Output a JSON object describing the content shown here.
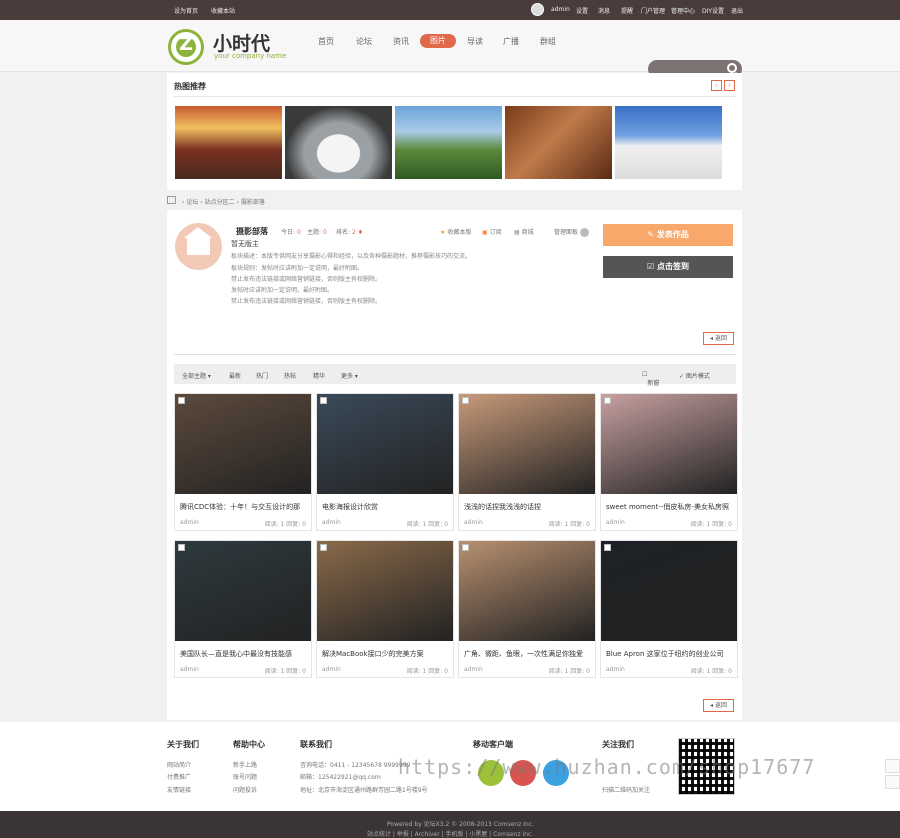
{
  "topbar": {
    "set_home": "设为首页",
    "bookmark": "收藏本站",
    "username": "admin",
    "links": [
      "设置",
      "消息",
      "提醒",
      "门户管理",
      "管理中心",
      "DIY设置",
      "退出"
    ]
  },
  "header": {
    "logo_letter": "Z",
    "brand": "小时代",
    "tagline": "your company name",
    "nav": [
      "首页",
      "论坛",
      "资讯",
      "图片",
      "导读",
      "广播",
      "群组"
    ],
    "nav_active": "图片"
  },
  "hot": {
    "title": "热图推荐",
    "prev": "‹",
    "next": "›",
    "images": [
      "conference-room",
      "white-car",
      "palace-garden",
      "painting-couple",
      "white-building"
    ]
  },
  "breadcrumb": [
    "›",
    "论坛",
    "›",
    "站点分区二",
    "›",
    "摄影部落"
  ],
  "forum": {
    "name": "摄影部落",
    "today_label": "今日:",
    "today": "0",
    "topics_label": "主题:",
    "topics": "0",
    "rank_label": "排名:",
    "rank": "2",
    "moderator": "暂无版主",
    "rules": [
      "板块描述：本版专供网友分享摄影心得和经验，以及各种摄影题材，推荐摄影技巧的交流。",
      "板块规则：发帖时应讲附加一定说明，最好附图。",
      "禁止发布违法链接或网络营销链接，否则版主有权删除。",
      "发帖时应讲附加一定说明，最好附图。",
      "禁止发布违法链接或网络营销链接，否则版主有权删除。"
    ],
    "actions": [
      "收藏本版",
      "订阅",
      "商城",
      "管理面板"
    ],
    "post_button": "发表作品",
    "sign_button": "点击签到",
    "back_label": "◂ 返回"
  },
  "filter": {
    "items": [
      "全部主题 ▾",
      "最新",
      "热门",
      "热帖",
      "精华",
      "更多 ▾"
    ],
    "new_window": "新窗",
    "mode": "✓ 图片模式"
  },
  "cards": [
    {
      "title": "腾讯CDC体验：十年！与交互设计的那",
      "author": "admin",
      "stats": "阅读: 1  回复: 0",
      "color": "#5d4a3c"
    },
    {
      "title": "电影海报设计欣赏",
      "author": "admin",
      "stats": "阅读: 1  回复: 0",
      "color": "#3a4a5a"
    },
    {
      "title": "浅浅的话捏我浅浅的话捏",
      "author": "admin",
      "stats": "阅读: 1  回复: 0",
      "color": "#c89a7a"
    },
    {
      "title": "sweet moment--俏皮私房-美女私房照",
      "author": "admin",
      "stats": "阅读: 1  回复: 0",
      "color": "#c8a0a0"
    },
    {
      "title": "美国队长—直是我心中最没有技能感",
      "author": "admin",
      "stats": "阅读: 1  回复: 0",
      "color": "#2e3a3e"
    },
    {
      "title": "解决MacBook接口少的完美方案",
      "author": "admin",
      "stats": "阅读: 1  回复: 0",
      "color": "#8a6a4a"
    },
    {
      "title": "广角、微距、鱼眼，一次性满足你独爱",
      "author": "admin",
      "stats": "阅读: 1  回复: 0",
      "color": "#b89070"
    },
    {
      "title": "Blue Apron 这家位于纽约的创业公司",
      "author": "admin",
      "stats": "阅读: 1  回复: 0",
      "color": "#1e2226"
    }
  ],
  "footer": {
    "about_title": "关于我们",
    "about": [
      "网站简介",
      "付费推广",
      "友情链接"
    ],
    "help_title": "帮助中心",
    "help": [
      "新手上路",
      "账号问题",
      "问题投诉"
    ],
    "contact_title": "联系我们",
    "contact": [
      "咨询电话：0411 - 12345678 9999999",
      "邮箱：125422921@qq.com",
      "地址：北京市海淀区通州路群芳园二路1号楼9号"
    ],
    "mobile_title": "移动客户端",
    "follow_title": "关注我们",
    "follow": [
      "扫描二维码加关注"
    ],
    "watermark": "https://www.huzhan.com/shop17677",
    "powered": "Powered by 论坛X3.2 © 2008-2013 Comsenz Inc.",
    "bottom_links": "站点统计 | 举报 | Archiver | 手机版 | 小黑屋 | Comsenz Inc."
  }
}
